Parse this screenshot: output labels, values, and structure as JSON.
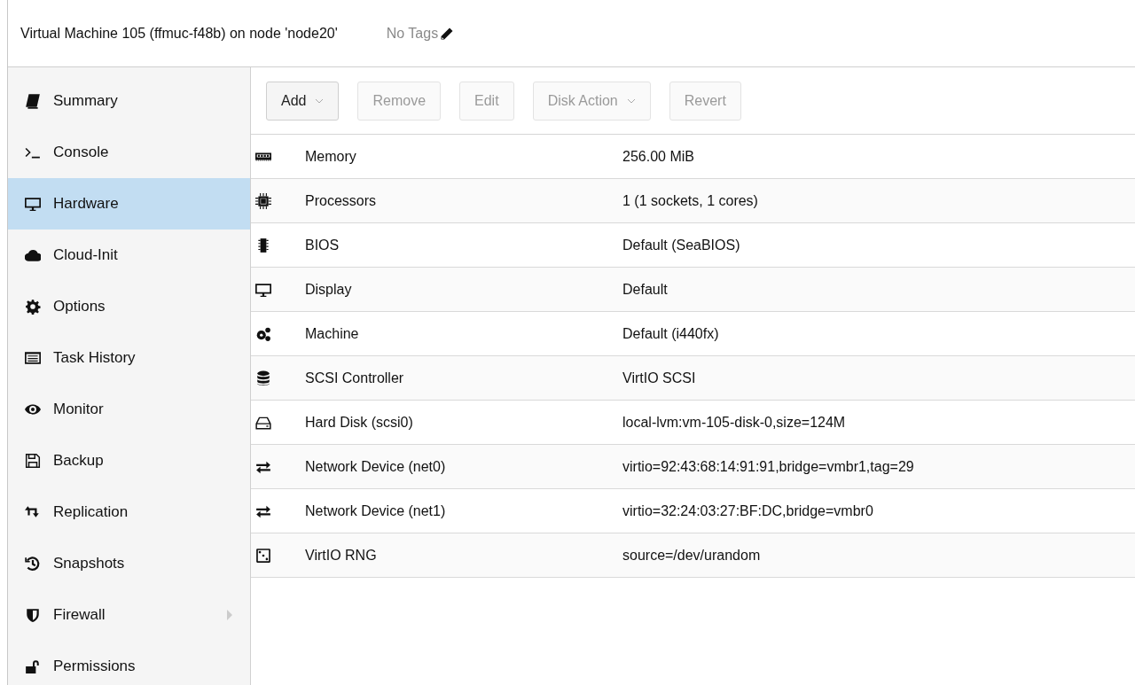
{
  "header": {
    "title": "Virtual Machine 105 (ffmuc-f48b) on node 'node20'",
    "tags": "No Tags"
  },
  "sidebar": {
    "items": [
      {
        "label": "Summary",
        "selected": false
      },
      {
        "label": "Console",
        "selected": false
      },
      {
        "label": "Hardware",
        "selected": true
      },
      {
        "label": "Cloud-Init",
        "selected": false
      },
      {
        "label": "Options",
        "selected": false
      },
      {
        "label": "Task History",
        "selected": false
      },
      {
        "label": "Monitor",
        "selected": false
      },
      {
        "label": "Backup",
        "selected": false
      },
      {
        "label": "Replication",
        "selected": false
      },
      {
        "label": "Snapshots",
        "selected": false
      },
      {
        "label": "Firewall",
        "selected": false,
        "submenu": true
      },
      {
        "label": "Permissions",
        "selected": false
      }
    ]
  },
  "toolbar": {
    "buttons": [
      {
        "label": "Add",
        "disabled": false,
        "menu": true
      },
      {
        "label": "Remove",
        "disabled": true,
        "menu": false
      },
      {
        "label": "Edit",
        "disabled": true,
        "menu": false
      },
      {
        "label": "Disk Action",
        "disabled": true,
        "menu": true
      },
      {
        "label": "Revert",
        "disabled": true,
        "menu": false
      }
    ]
  },
  "table": {
    "rows": [
      {
        "name": "Memory",
        "value": "256.00 MiB"
      },
      {
        "name": "Processors",
        "value": "1 (1 sockets, 1 cores)"
      },
      {
        "name": "BIOS",
        "value": "Default (SeaBIOS)"
      },
      {
        "name": "Display",
        "value": "Default"
      },
      {
        "name": "Machine",
        "value": "Default (i440fx)"
      },
      {
        "name": "SCSI Controller",
        "value": "VirtIO SCSI"
      },
      {
        "name": "Hard Disk (scsi0)",
        "value": "local-lvm:vm-105-disk-0,size=124M"
      },
      {
        "name": "Network Device (net0)",
        "value": "virtio=92:43:68:14:91:91,bridge=vmbr1,tag=29"
      },
      {
        "name": "Network Device (net1)",
        "value": "virtio=32:24:03:27:BF:DC,bridge=vmbr0"
      },
      {
        "name": "VirtIO RNG",
        "value": "source=/dev/urandom"
      }
    ]
  }
}
